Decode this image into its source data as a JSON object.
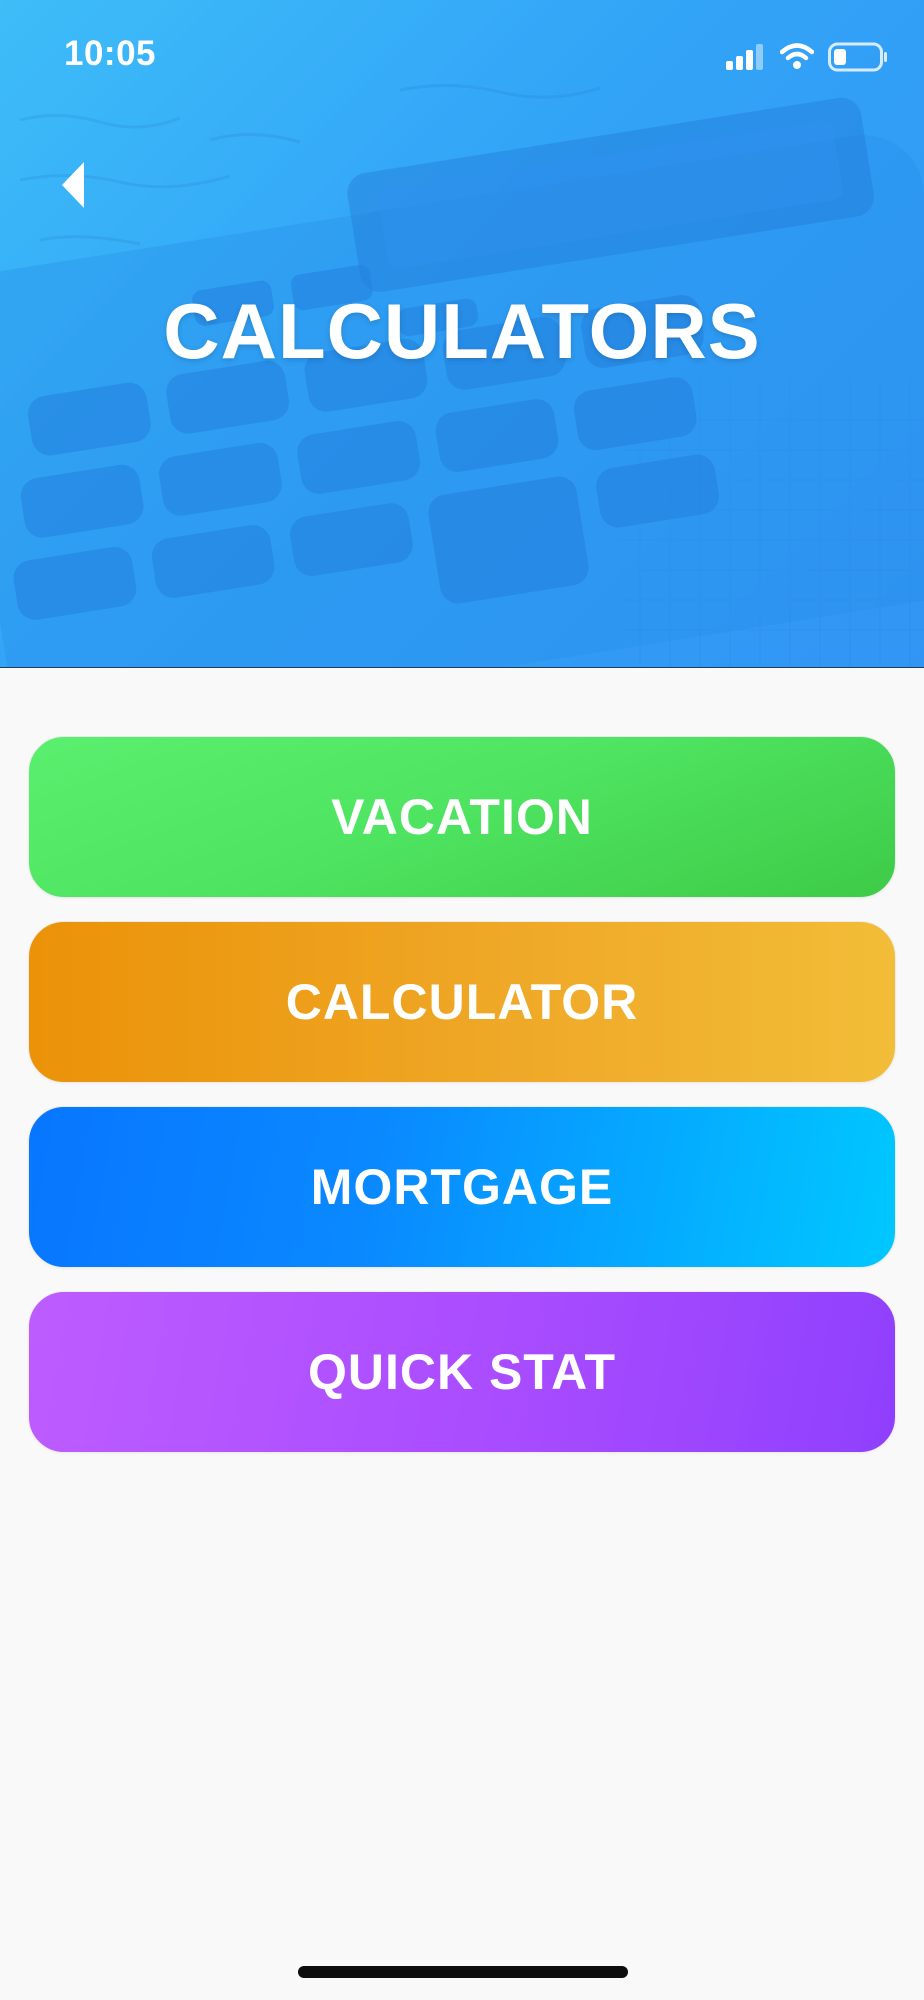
{
  "status_bar": {
    "time": "10:05",
    "icons": [
      "signal-icon",
      "wifi-icon",
      "battery-icon"
    ]
  },
  "header": {
    "title": "CALCULATORS",
    "back_icon": "chevron-left-icon",
    "background_image": "calculator-photo"
  },
  "menu": {
    "items": [
      {
        "label": "VACATION",
        "colors": [
          "#5aef6e",
          "#3ecb47"
        ]
      },
      {
        "label": "CALCULATOR",
        "colors": [
          "#eb9208",
          "#f2bd38"
        ]
      },
      {
        "label": "MORTGAGE",
        "colors": [
          "#0876ff",
          "#00c8ff"
        ]
      },
      {
        "label": "QUICK STAT",
        "colors": [
          "#bd5cff",
          "#8f40fd"
        ]
      }
    ]
  },
  "theme": {
    "header_gradient": [
      "#3fc4f9",
      "#2f8ff3"
    ],
    "text_color": "#ffffff",
    "background": "#f9f9f9"
  }
}
